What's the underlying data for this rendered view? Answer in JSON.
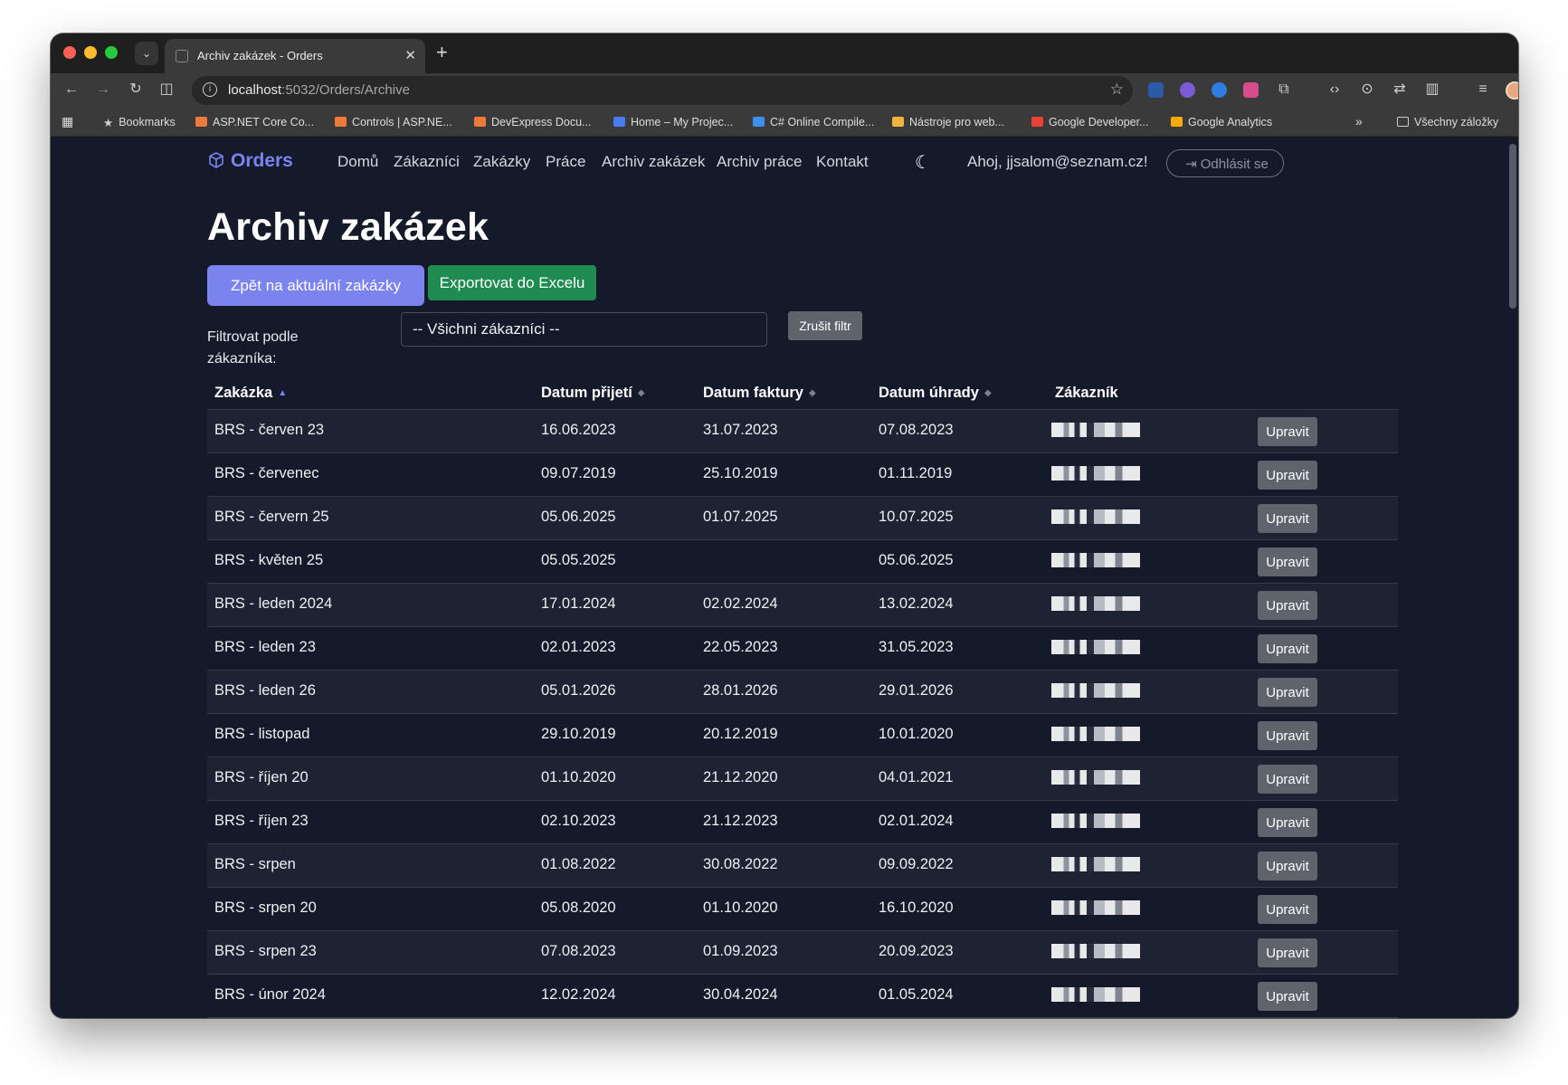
{
  "browser": {
    "tab_title": "Archiv zakázek - Orders",
    "url_host": "localhost",
    "url_path": ":5032/Orders/Archive",
    "bookmarks": [
      {
        "label": "Bookmarks",
        "color": "#cfcfcf"
      },
      {
        "label": "ASP.NET Core Co...",
        "color": "#f07a3c"
      },
      {
        "label": "Controls | ASP.NE...",
        "color": "#f07a3c"
      },
      {
        "label": "DevExpress Docu...",
        "color": "#f07a3c"
      },
      {
        "label": "Home – My Projec...",
        "color": "#4b7bf0"
      },
      {
        "label": "C# Online Compile...",
        "color": "#3c8ef0"
      },
      {
        "label": "Nástroje pro web...",
        "color": "#f0b33c"
      },
      {
        "label": "Google Developer...",
        "color": "#ea4335"
      },
      {
        "label": "Google Analytics",
        "color": "#f9ab00"
      }
    ],
    "all_bookmarks": "Všechny záložky"
  },
  "nav": {
    "brand": "Orders",
    "links": [
      "Domů",
      "Zákazníci",
      "Zakázky",
      "Práce",
      "Archiv zakázek",
      "Archiv práce",
      "Kontakt"
    ],
    "greeting": "Ahoj, jjsalom@seznam.cz!",
    "logout": "Odhlásit se"
  },
  "page": {
    "title": "Archiv zakázek",
    "back_button": "Zpět na aktuální zakázky",
    "export_button": "Exportovat do Excelu",
    "filter_label": "Filtrovat podle zákazníka:",
    "filter_value": "-- Všichni zákazníci --",
    "clear_filter": "Zrušit filtr"
  },
  "table": {
    "headers": [
      "Zakázka",
      "Datum přijetí",
      "Datum faktury",
      "Datum úhrady",
      "Zákazník"
    ],
    "edit_label": "Upravit",
    "rows": [
      {
        "name": "BRS - červen 23",
        "received": "16.06.2023",
        "invoice": "31.07.2023",
        "paid": "07.08.2023"
      },
      {
        "name": "BRS - červenec",
        "received": "09.07.2019",
        "invoice": "25.10.2019",
        "paid": "01.11.2019"
      },
      {
        "name": "BRS - červern 25",
        "received": "05.06.2025",
        "invoice": "01.07.2025",
        "paid": "10.07.2025"
      },
      {
        "name": "BRS - květen 25",
        "received": "05.05.2025",
        "invoice": "",
        "paid": "05.06.2025"
      },
      {
        "name": "BRS - leden 2024",
        "received": "17.01.2024",
        "invoice": "02.02.2024",
        "paid": "13.02.2024"
      },
      {
        "name": "BRS - leden 23",
        "received": "02.01.2023",
        "invoice": "22.05.2023",
        "paid": "31.05.2023"
      },
      {
        "name": "BRS - leden 26",
        "received": "05.01.2026",
        "invoice": "28.01.2026",
        "paid": "29.01.2026"
      },
      {
        "name": "BRS - listopad",
        "received": "29.10.2019",
        "invoice": "20.12.2019",
        "paid": "10.01.2020"
      },
      {
        "name": "BRS - říjen 20",
        "received": "01.10.2020",
        "invoice": "21.12.2020",
        "paid": "04.01.2021"
      },
      {
        "name": "BRS - říjen 23",
        "received": "02.10.2023",
        "invoice": "21.12.2023",
        "paid": "02.01.2024"
      },
      {
        "name": "BRS - srpen",
        "received": "01.08.2022",
        "invoice": "30.08.2022",
        "paid": "09.09.2022"
      },
      {
        "name": "BRS - srpen 20",
        "received": "05.08.2020",
        "invoice": "01.10.2020",
        "paid": "16.10.2020"
      },
      {
        "name": "BRS - srpen 23",
        "received": "07.08.2023",
        "invoice": "01.09.2023",
        "paid": "20.09.2023"
      },
      {
        "name": "BRS - únor 2024",
        "received": "12.02.2024",
        "invoice": "30.04.2024",
        "paid": "01.05.2024"
      }
    ]
  }
}
